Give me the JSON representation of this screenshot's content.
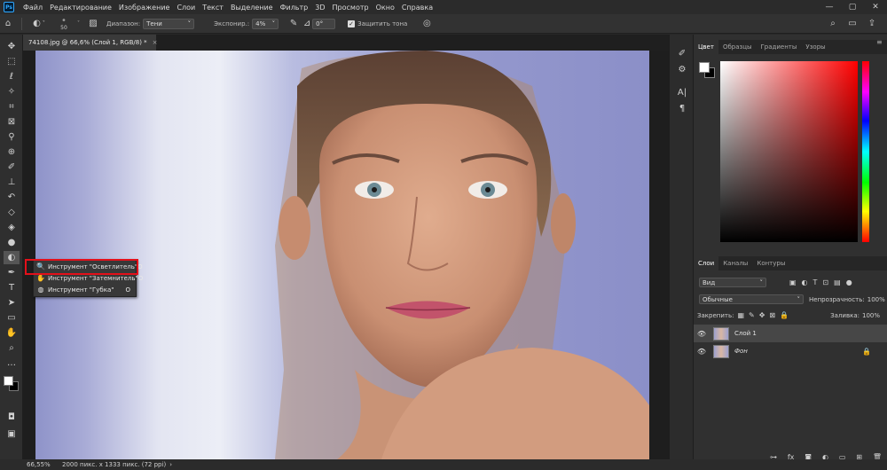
{
  "app": {
    "logo": "Ps"
  },
  "menu": [
    "Файл",
    "Редактирование",
    "Изображение",
    "Слои",
    "Текст",
    "Выделение",
    "Фильтр",
    "3D",
    "Просмотр",
    "Окно",
    "Справка"
  ],
  "window_controls": {
    "minimize": "—",
    "maximize": "▢",
    "close": "✕"
  },
  "options": {
    "brush_size": "50",
    "range_label": "Диапазон:",
    "range_value": "Тени",
    "exposure_label": "Экспонир.:",
    "exposure_value": "4%",
    "angle_value": "0°",
    "protect_tones_label": "Защитить тона",
    "protect_tones_checked": true
  },
  "document_tab": {
    "title": "74108.jpg @ 66,6% (Слой 1, RGB/8) *",
    "close": "×"
  },
  "flyout": {
    "items": [
      {
        "label": "Инструмент \"Осветлитель\"",
        "key": "O",
        "icon": "dodge-icon",
        "glyph": "🔍",
        "active": true
      },
      {
        "label": "Инструмент \"Затемнитель\"",
        "key": "O",
        "icon": "burn-icon",
        "glyph": "✋",
        "active": false
      },
      {
        "label": "Инструмент \"Губка\"",
        "key": "O",
        "icon": "sponge-icon",
        "glyph": "◍",
        "active": false
      }
    ]
  },
  "status": {
    "zoom": "66,55%",
    "doc_info": "2000 пикс. x 1333 пикс. (72 ppi)"
  },
  "color_panel": {
    "tabs": [
      "Цвет",
      "Образцы",
      "Градиенты",
      "Узоры"
    ],
    "active_tab": "Цвет",
    "foreground": "#ffffff",
    "background": "#000000"
  },
  "layers_panel": {
    "tabs": [
      "Слои",
      "Каналы",
      "Контуры"
    ],
    "active_tab": "Слои",
    "filter_kind": "Вид",
    "blend_mode": "Обычные",
    "opacity_label": "Непрозрачность:",
    "opacity_value": "100%",
    "lock_label": "Закрепить:",
    "fill_label": "Заливка:",
    "fill_value": "100%",
    "layers": [
      {
        "name": "Слой 1",
        "selected": true,
        "visible": true,
        "locked": false
      },
      {
        "name": "Фон",
        "selected": false,
        "visible": true,
        "locked": true
      }
    ]
  }
}
